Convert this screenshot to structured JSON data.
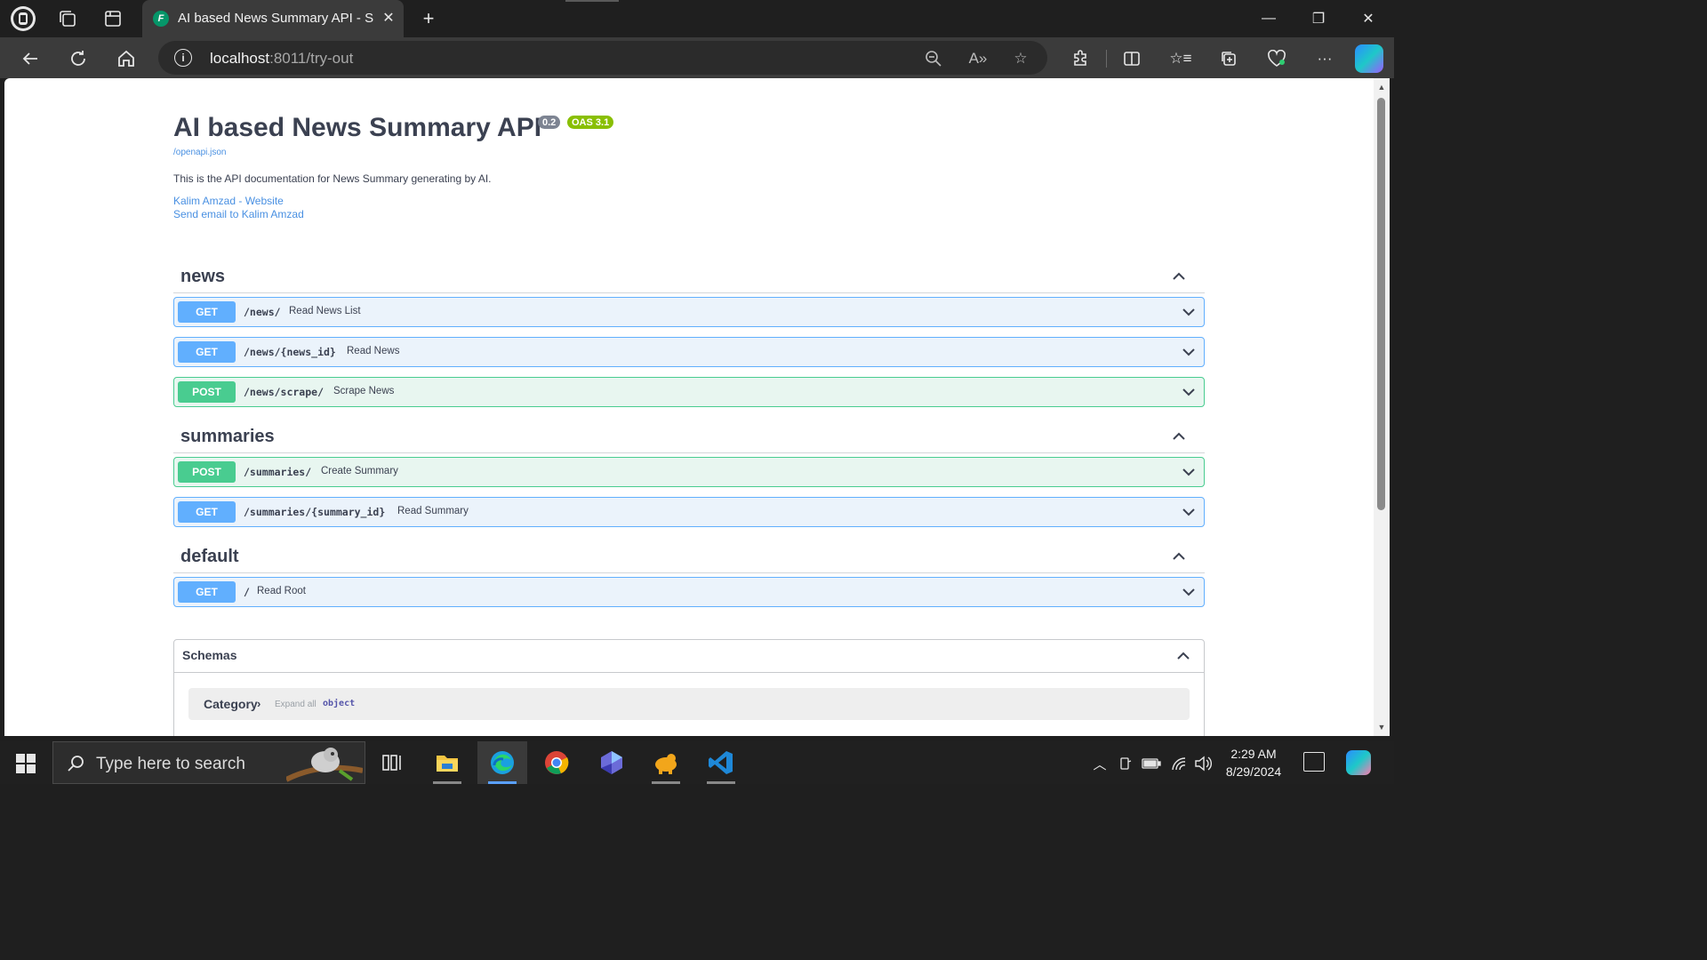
{
  "browser": {
    "tab": {
      "title": "AI based News Summary API - Sw",
      "favicon_letter": "F"
    },
    "address": {
      "host": "localhost",
      "rest": ":8011/try-out"
    },
    "window_controls": {
      "minimize": "—",
      "restore": "❐",
      "close": "✕"
    }
  },
  "page": {
    "title": "AI based News Summary API",
    "version_badge": "0.2",
    "oas_badge": "OAS 3.1",
    "spec_link": "/openapi.json",
    "description": "This is the API documentation for News Summary generating by AI.",
    "contact_website": "Kalim Amzad - Website",
    "contact_email": "Send email to Kalim Amzad"
  },
  "sections": [
    {
      "name": "news",
      "operations": [
        {
          "method": "GET",
          "path": "/news/",
          "summary": "Read News List"
        },
        {
          "method": "GET",
          "path": "/news/{news_id}",
          "summary": "Read News"
        },
        {
          "method": "POST",
          "path": "/news/scrape/",
          "summary": "Scrape News"
        }
      ]
    },
    {
      "name": "summaries",
      "operations": [
        {
          "method": "POST",
          "path": "/summaries/",
          "summary": "Create Summary"
        },
        {
          "method": "GET",
          "path": "/summaries/{summary_id}",
          "summary": "Read Summary"
        }
      ]
    },
    {
      "name": "default",
      "operations": [
        {
          "method": "GET",
          "path": "/",
          "summary": "Read Root"
        }
      ]
    }
  ],
  "schemas": {
    "title": "Schemas",
    "models": [
      {
        "name": "Category",
        "expand_label": "Expand all",
        "type": "object"
      }
    ]
  },
  "taskbar": {
    "search_placeholder": "Type here to search",
    "time": "2:29 AM",
    "date": "8/29/2024"
  },
  "colors": {
    "get": "#61affe",
    "post": "#49cc90",
    "link": "#4990e2",
    "text": "#3b4151"
  }
}
